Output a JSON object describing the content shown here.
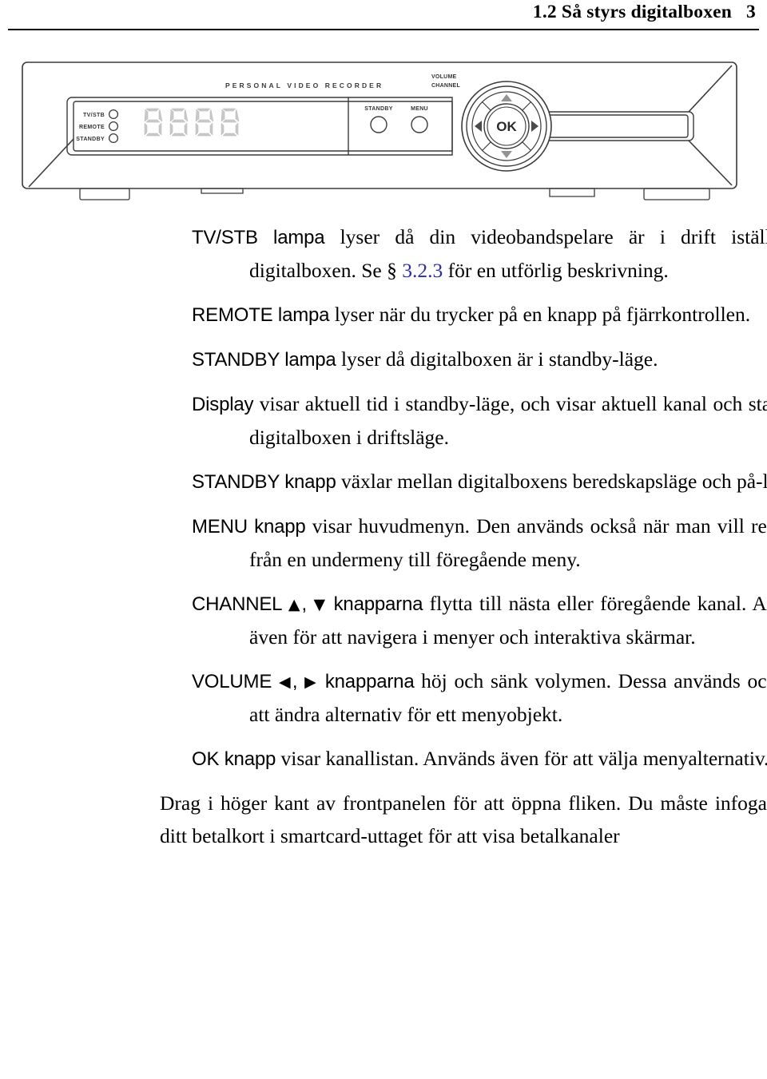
{
  "header": {
    "section_number": "1.2",
    "title": "1.2 Så styrs digitalboxen",
    "page_number": "3"
  },
  "device": {
    "brand_label": "PERSONAL VIDEO RECORDER",
    "leds": [
      {
        "label": "TV/STB",
        "icon": "led-indicator"
      },
      {
        "label": "REMOTE",
        "icon": "led-indicator"
      },
      {
        "label": "STANDBY",
        "icon": "led-indicator"
      }
    ],
    "display": {
      "name": "seven-segment-display",
      "digits": [
        "8",
        "8",
        "8",
        "8"
      ],
      "segment_color": "#c9c9c9"
    },
    "buttons": [
      {
        "label": "STANDBY",
        "icon": "round-button"
      },
      {
        "label": "MENU",
        "icon": "round-button"
      }
    ],
    "navpad": {
      "volume_label": "VOLUME",
      "channel_label": "CHANNEL",
      "ok_label": "OK",
      "up_icon": "triangle-up-icon",
      "down_icon": "triangle-down-icon",
      "left_icon": "triangle-left-icon",
      "right_icon": "triangle-right-icon"
    },
    "outline_color": "#3a3a3a"
  },
  "body": {
    "paragraphs": [
      {
        "id": "tvstb",
        "term": "TV/STB lampa",
        "text_before_link": " lyser då din videobandspelare är i drift istället för digitalboxen. Se § ",
        "link": "3.2.3",
        "text_after_link": " för en utförlig beskrivning."
      },
      {
        "id": "remote",
        "term": "REMOTE lampa",
        "text": " lyser när du trycker på en knapp på fjärrkontrollen."
      },
      {
        "id": "standby-lamp",
        "term": "STANDBY lampa",
        "text": " lyser då digitalboxen är i standby-läge."
      },
      {
        "id": "display",
        "term": "Display",
        "text": " visar aktuell tid i standby-läge, och visar aktuell kanal och status för digitalboxen i driftsläge."
      },
      {
        "id": "standby-button",
        "term": "STANDBY knapp",
        "text": " växlar mellan digitalboxens beredskapsläge och på-läge."
      },
      {
        "id": "menu-button",
        "term": "MENU knapp",
        "text": " visar huvudmenyn. Den används också när man vill returnera från en undermeny till föregående meny."
      },
      {
        "id": "channel-buttons",
        "term_prefix": "CHANNEL ",
        "glyph_1": "▲",
        "term_sep": ", ",
        "glyph_2": "▼",
        "term_suffix": " knapparna",
        "text": " flytta till nästa eller föregående kanal. Används även för att navigera i menyer och interaktiva skärmar."
      },
      {
        "id": "volume-buttons",
        "term_prefix": "VOLUME ",
        "glyph_1": "◀",
        "term_sep": ", ",
        "glyph_2": "▶",
        "term_suffix": " knapparna",
        "text": " höj och sänk volymen. Dessa används också för att ändra alternativ för ett menyobjekt."
      },
      {
        "id": "ok-button",
        "term": "OK knapp",
        "text": " visar kanallistan. Används även för att välja menyalternativ."
      },
      {
        "id": "tab-note",
        "text": "Drag i höger kant av frontpanelen för att öppna fliken. Du måste infoga ditt betalkort i smartcard-uttaget för att visa betalkanaler"
      }
    ]
  }
}
